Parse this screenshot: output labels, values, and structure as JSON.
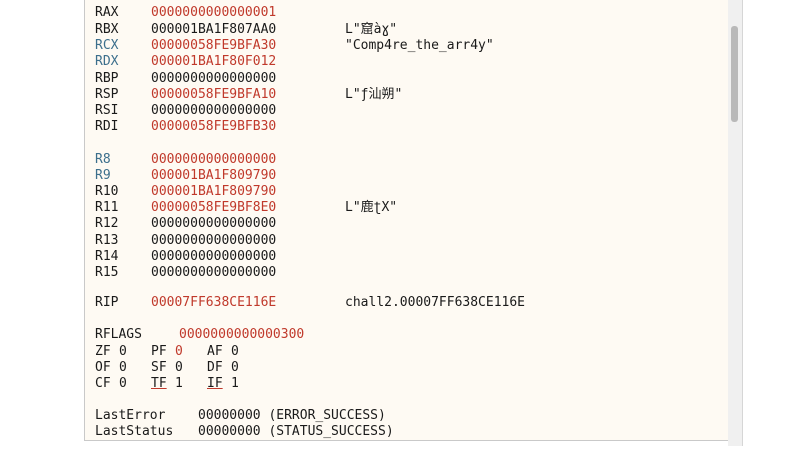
{
  "registers": [
    {
      "name": "RAX",
      "value": "0000000000000001",
      "changed": true,
      "name_blue": false,
      "comment": ""
    },
    {
      "name": "RBX",
      "value": "000001BA1F807AA0",
      "changed": false,
      "name_blue": false,
      "comment": "L\"窟àɣ\""
    },
    {
      "name": "RCX",
      "value": "00000058FE9BFA30",
      "changed": true,
      "name_blue": true,
      "comment": "\"Comp4re_the_arr4y\""
    },
    {
      "name": "RDX",
      "value": "000001BA1F80F012",
      "changed": true,
      "name_blue": true,
      "comment": ""
    },
    {
      "name": "RBP",
      "value": "0000000000000000",
      "changed": false,
      "name_blue": false,
      "comment": ""
    },
    {
      "name": "RSP",
      "value": "00000058FE9BFA10",
      "changed": true,
      "name_blue": false,
      "comment": "L\"ƒ汕朔\""
    },
    {
      "name": "RSI",
      "value": "0000000000000000",
      "changed": false,
      "name_blue": false,
      "comment": ""
    },
    {
      "name": "RDI",
      "value": "00000058FE9BFB30",
      "changed": true,
      "name_blue": false,
      "comment": ""
    },
    {
      "name": "R8",
      "value": "0000000000000000",
      "changed": true,
      "name_blue": true,
      "comment": ""
    },
    {
      "name": "R9",
      "value": "000001BA1F809790",
      "changed": true,
      "name_blue": true,
      "comment": ""
    },
    {
      "name": "R10",
      "value": "000001BA1F809790",
      "changed": true,
      "name_blue": false,
      "comment": ""
    },
    {
      "name": "R11",
      "value": "00000058FE9BF8E0",
      "changed": true,
      "name_blue": false,
      "comment": "L\"鹿ʈX\""
    },
    {
      "name": "R12",
      "value": "0000000000000000",
      "changed": false,
      "name_blue": false,
      "comment": ""
    },
    {
      "name": "R13",
      "value": "0000000000000000",
      "changed": false,
      "name_blue": false,
      "comment": ""
    },
    {
      "name": "R14",
      "value": "0000000000000000",
      "changed": false,
      "name_blue": false,
      "comment": ""
    },
    {
      "name": "R15",
      "value": "0000000000000000",
      "changed": false,
      "name_blue": false,
      "comment": ""
    }
  ],
  "rip": {
    "name": "RIP",
    "value": "00007FF638CE116E",
    "changed": true,
    "comment": "chall2.00007FF638CE116E"
  },
  "rflags": {
    "name": "RFLAGS",
    "value": "0000000000000300",
    "changed": true
  },
  "flags": [
    [
      {
        "name": "ZF",
        "value": "0",
        "changed": false,
        "underline": false
      },
      {
        "name": "PF",
        "value": "0",
        "changed": true,
        "underline": false
      },
      {
        "name": "AF",
        "value": "0",
        "changed": false,
        "underline": false
      }
    ],
    [
      {
        "name": "OF",
        "value": "0",
        "changed": false,
        "underline": false
      },
      {
        "name": "SF",
        "value": "0",
        "changed": false,
        "underline": false
      },
      {
        "name": "DF",
        "value": "0",
        "changed": false,
        "underline": false
      }
    ],
    [
      {
        "name": "CF",
        "value": "0",
        "changed": false,
        "underline": false
      },
      {
        "name": "TF",
        "value": "1",
        "changed": false,
        "underline": true
      },
      {
        "name": "IF",
        "value": "1",
        "changed": false,
        "underline": true
      }
    ]
  ],
  "last_error": {
    "label": "LastError",
    "value": "00000000 (ERROR_SUCCESS)"
  },
  "last_status": {
    "label": "LastStatus",
    "value": "00000000 (STATUS_SUCCESS)"
  },
  "colors": {
    "changed": "#c0392b",
    "normal": "#1a1a1a",
    "register_blue": "#3c6f8c",
    "panel_background": "#fefaf3"
  }
}
